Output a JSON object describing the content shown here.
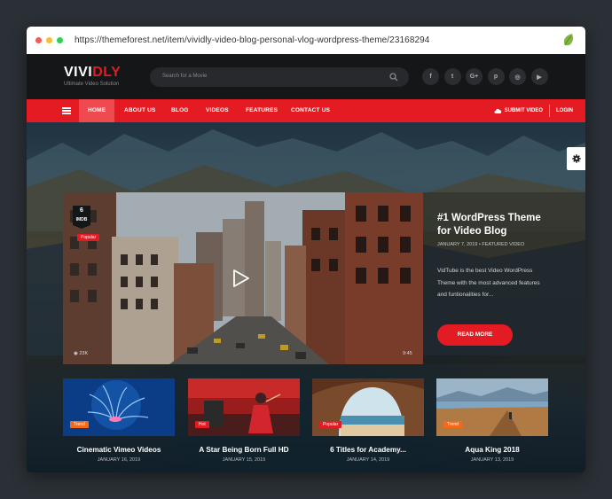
{
  "browser": {
    "url": "https://themeforest.net/item/vividly-video-blog-personal-vlog-wordpress-theme/23168294",
    "dot_colors": [
      "#f25c54",
      "#f6be3a",
      "#2fcf57"
    ]
  },
  "header": {
    "logo_part1": "VIVI",
    "logo_part2": "DLY",
    "tagline": "Ultimate Video Solution",
    "search_placeholder": "Search for a Movie",
    "socials": [
      {
        "icon": "facebook-icon",
        "glyph": "f"
      },
      {
        "icon": "twitter-icon",
        "glyph": "t"
      },
      {
        "icon": "google-plus-icon",
        "glyph": "G+"
      },
      {
        "icon": "pinterest-icon",
        "glyph": "p"
      },
      {
        "icon": "instagram-icon",
        "glyph": "◎"
      },
      {
        "icon": "youtube-icon",
        "glyph": "▶"
      }
    ]
  },
  "nav": {
    "items": [
      "HOME",
      "ABOUT US",
      "BLOG",
      "VIDEOS",
      "FEATURES",
      "CONTACT US"
    ],
    "submit_video": "SUBMIT VIDEO",
    "login": "LOGIN",
    "accent": "#e41b23"
  },
  "hero": {
    "imdb_score": "6",
    "imdb_label": "IMDB",
    "badge": "Popular",
    "views": "23K",
    "duration": "9:45",
    "title": "#1 WordPress Theme for Video Blog",
    "date": "JANUARY 7, 2019",
    "category": "FEATURED VIDEO",
    "meta_separator": "•",
    "description": "VidTube is the best Video WordPress Theme with the most advanced features and funtionalities for...",
    "cta": "READ MORE"
  },
  "cards": [
    {
      "badge": "Trend",
      "badge_color": "#f46a1b",
      "title": "Cinematic Vimeo Videos",
      "date": "JANUARY 16, 2019"
    },
    {
      "badge": "Hot",
      "badge_color": "#e41b23",
      "title": "A Star Being Born Full HD",
      "date": "JANUARY 15, 2019"
    },
    {
      "badge": "Popular",
      "badge_color": "#e41b23",
      "title": "6 Titles for Academy...",
      "date": "JANUARY 14, 2019"
    },
    {
      "badge": "Trend",
      "badge_color": "#f46a1b",
      "title": "Aqua King 2018",
      "date": "JANUARY 13, 2019"
    }
  ]
}
